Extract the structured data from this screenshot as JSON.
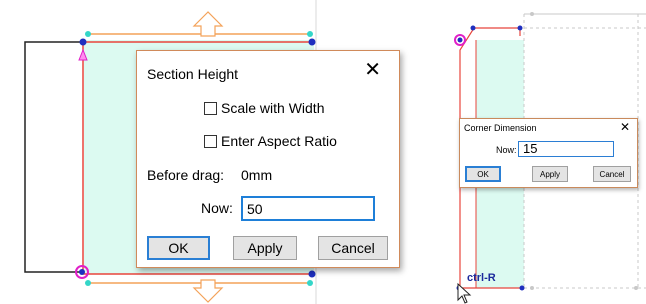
{
  "section_height_dialog": {
    "title": "Section Height",
    "close_glyph": "✕",
    "scale_with_width_label": "Scale with Width",
    "scale_with_width_checked": false,
    "enter_aspect_ratio_label": "Enter Aspect Ratio",
    "enter_aspect_ratio_checked": false,
    "before_drag_label": "Before drag:",
    "before_drag_value": "0mm",
    "now_label": "Now:",
    "now_value": "50",
    "ok_label": "OK",
    "apply_label": "Apply",
    "cancel_label": "Cancel"
  },
  "corner_dimension_dialog": {
    "title": "Corner Dimension",
    "close_glyph": "✕",
    "now_label": "Now:",
    "now_value": "15",
    "ok_label": "OK",
    "apply_label": "Apply",
    "cancel_label": "Cancel"
  },
  "canvas": {
    "shortcut_hint": "ctrl-R",
    "colors": {
      "section_fill": "#dcfaf1",
      "outline_red": "#e8453c",
      "outline_orange": "#f4a259",
      "handle_blue": "#1f2fbf",
      "handle_magenta": "#e020c8",
      "handle_cyan": "#34d6c8",
      "gray_dashed": "#c8c8c8"
    }
  }
}
